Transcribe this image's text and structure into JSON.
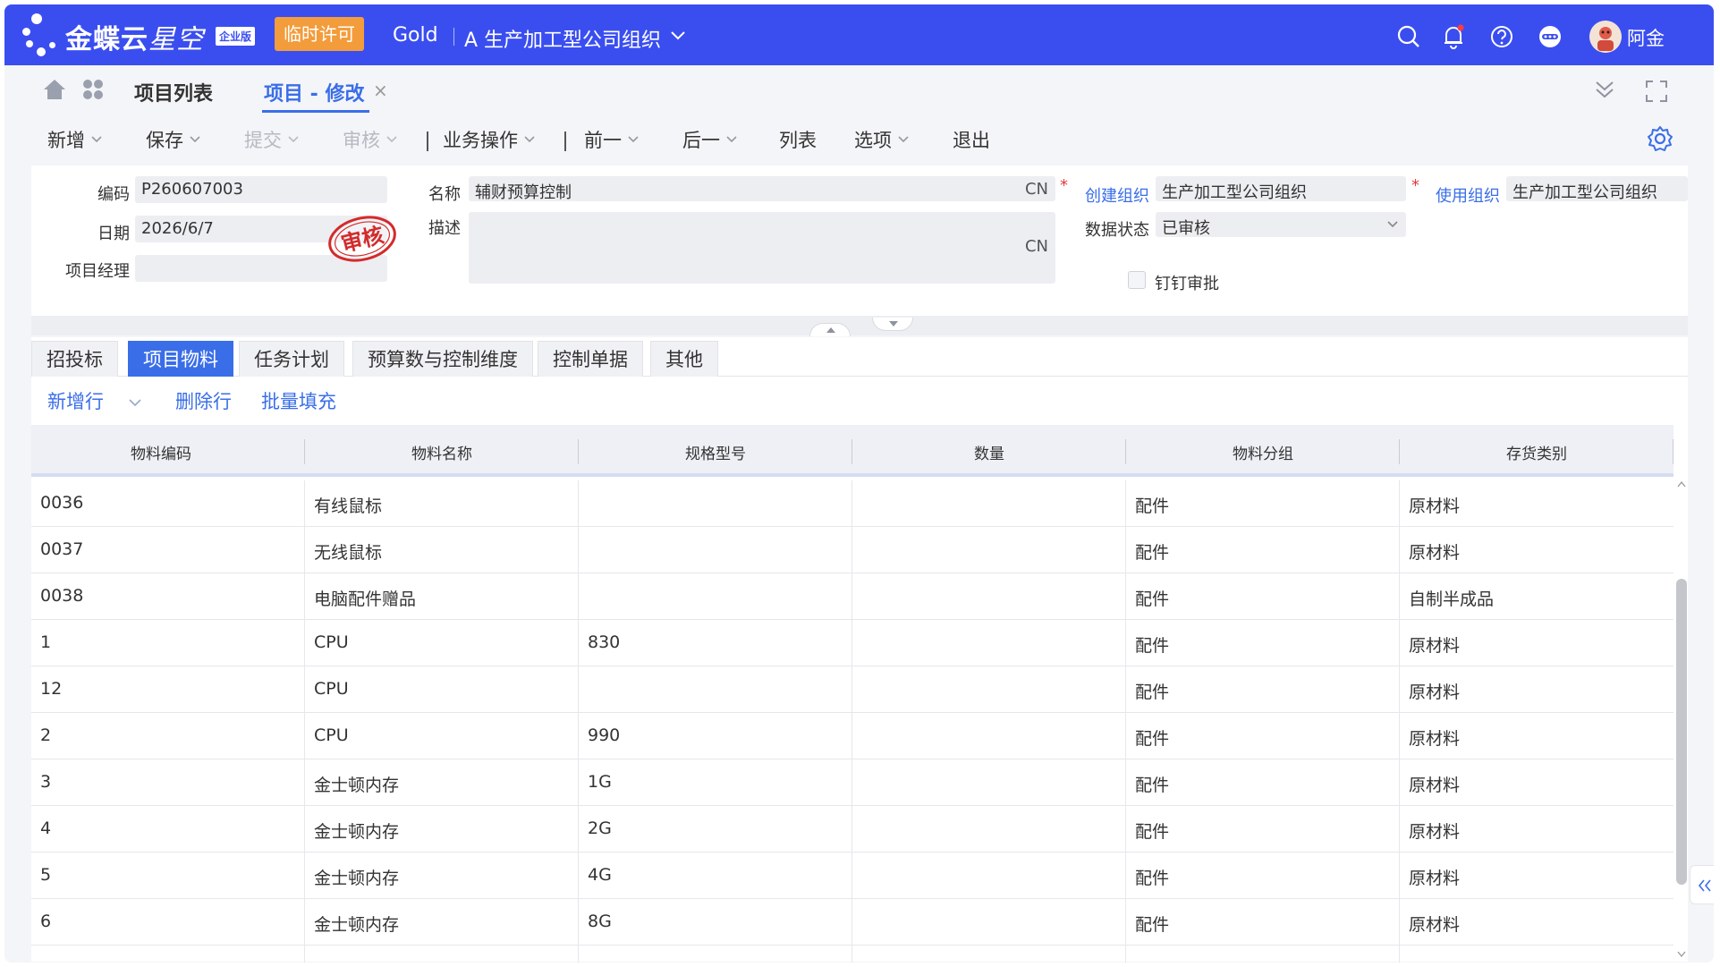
{
  "app": {
    "brand": "金蝶云",
    "brand_italic": "星空",
    "edition": "企业版",
    "license_badge": "临时许可",
    "tenant": "Gold",
    "org": "A 生产加工型公司组织",
    "user": "阿金",
    "accent": "#3a4ef0"
  },
  "tabs": {
    "list": "项目列表",
    "active": "项目 - 修改",
    "close": "×"
  },
  "toolbar": {
    "new": "新增",
    "save": "保存",
    "submit": "提交",
    "audit": "审核",
    "business": "业务操作",
    "prev": "前一",
    "next": "后一",
    "list": "列表",
    "options": "选项",
    "exit": "退出"
  },
  "form": {
    "code_label": "编码",
    "code_value": "P260607003",
    "date_label": "日期",
    "date_value": "2026/6/7",
    "manager_label": "项目经理",
    "manager_value": "",
    "name_label": "名称",
    "name_value": "辅财预算控制",
    "name_lang": "CN",
    "desc_label": "描述",
    "desc_value": "",
    "desc_lang": "CN",
    "create_org_label": "创建组织",
    "create_org_value": "生产加工型公司组织",
    "use_org_label": "使用组织",
    "use_org_value": "生产加工型公司组织",
    "status_label": "数据状态",
    "status_value": "已审核",
    "dingding_label": "钉钉审批",
    "stamp_text": "审核",
    "required_mark": "*"
  },
  "subtabs": [
    "招投标",
    "项目物料",
    "任务计划",
    "预算数与控制维度",
    "控制单据",
    "其他"
  ],
  "row_actions": {
    "add_row": "新增行",
    "delete_row": "删除行",
    "batch_fill": "批量填充"
  },
  "table": {
    "columns": [
      "物料编码",
      "物料名称",
      "规格型号",
      "数量",
      "物料分组",
      "存货类别"
    ],
    "rows": [
      [
        "0036",
        "有线鼠标",
        "",
        "",
        "配件",
        "原材料"
      ],
      [
        "0037",
        "无线鼠标",
        "",
        "",
        "配件",
        "原材料"
      ],
      [
        "0038",
        "电脑配件赠品",
        "",
        "",
        "配件",
        "自制半成品"
      ],
      [
        "1",
        "CPU",
        "830",
        "",
        "配件",
        "原材料"
      ],
      [
        "12",
        "CPU",
        "",
        "",
        "配件",
        "原材料"
      ],
      [
        "2",
        "CPU",
        "990",
        "",
        "配件",
        "原材料"
      ],
      [
        "3",
        "金士顿内存",
        "1G",
        "",
        "配件",
        "原材料"
      ],
      [
        "4",
        "金士顿内存",
        "2G",
        "",
        "配件",
        "原材料"
      ],
      [
        "5",
        "金士顿内存",
        "4G",
        "",
        "配件",
        "原材料"
      ],
      [
        "6",
        "金士顿内存",
        "8G",
        "",
        "配件",
        "原材料"
      ]
    ]
  }
}
